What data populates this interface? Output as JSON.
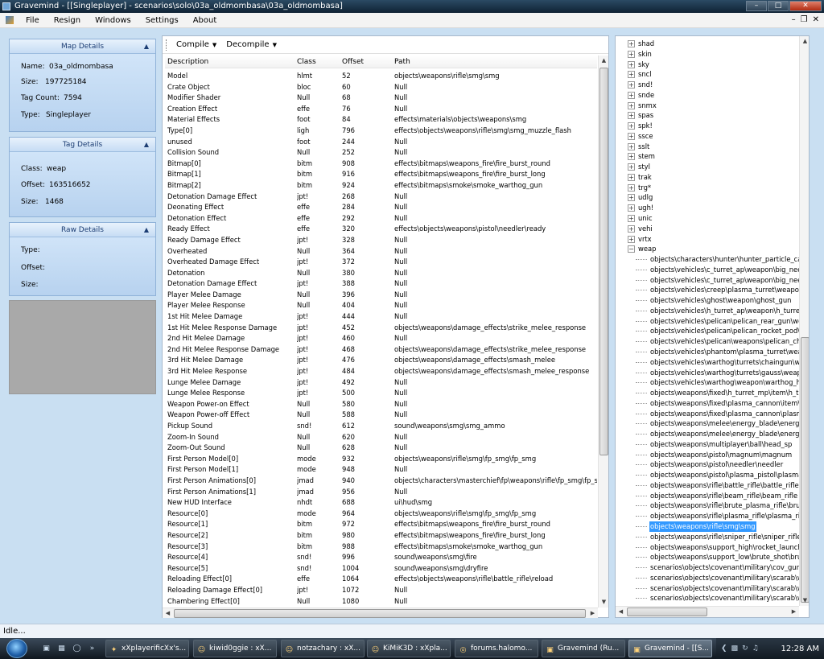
{
  "window": {
    "title": "Gravemind - [[Singleplayer] - scenarios\\solo\\03a_oldmombasa\\03a_oldmombasa]"
  },
  "menu": [
    "File",
    "Resign",
    "Windows",
    "Settings",
    "About"
  ],
  "map_details": {
    "title": "Map Details",
    "rows": [
      {
        "k": "Name:",
        "v": "03a_oldmombasa"
      },
      {
        "k": "Size:",
        "v": "197725184"
      },
      {
        "k": "Tag Count:",
        "v": "7594"
      },
      {
        "k": "Type:",
        "v": "Singleplayer"
      }
    ]
  },
  "tag_details": {
    "title": "Tag Details",
    "rows": [
      {
        "k": "Class:",
        "v": "weap"
      },
      {
        "k": "Offset:",
        "v": "163516652"
      },
      {
        "k": "Size:",
        "v": "1468"
      }
    ]
  },
  "raw_details": {
    "title": "Raw Details",
    "rows": [
      {
        "k": "Type:",
        "v": ""
      },
      {
        "k": "Offset:",
        "v": ""
      },
      {
        "k": "Size:",
        "v": ""
      }
    ]
  },
  "toolbar": {
    "compile": "Compile",
    "decompile": "Decompile"
  },
  "table": {
    "headers": [
      "Description",
      "Class",
      "Offset",
      "Path"
    ],
    "rows": [
      [
        "Model",
        "hlmt",
        "52",
        "objects\\weapons\\rifle\\smg\\smg"
      ],
      [
        "Crate Object",
        "bloc",
        "60",
        "Null"
      ],
      [
        "Modifier Shader",
        "Null",
        "68",
        "Null"
      ],
      [
        "Creation Effect",
        "effe",
        "76",
        "Null"
      ],
      [
        "Material Effects",
        "foot",
        "84",
        "effects\\materials\\objects\\weapons\\smg"
      ],
      [
        "Type[0]",
        "ligh",
        "796",
        "effects\\objects\\weapons\\rifle\\smg\\smg_muzzle_flash"
      ],
      [
        "unused",
        "foot",
        "244",
        "Null"
      ],
      [
        "Collision Sound",
        "Null",
        "252",
        "Null"
      ],
      [
        "Bitmap[0]",
        "bitm",
        "908",
        "effects\\bitmaps\\weapons_fire\\fire_burst_round"
      ],
      [
        "Bitmap[1]",
        "bitm",
        "916",
        "effects\\bitmaps\\weapons_fire\\fire_burst_long"
      ],
      [
        "Bitmap[2]",
        "bitm",
        "924",
        "effects\\bitmaps\\smoke\\smoke_warthog_gun"
      ],
      [
        "Detonation Damage Effect",
        "jpt!",
        "268",
        "Null"
      ],
      [
        "Deonating Effect",
        "effe",
        "284",
        "Null"
      ],
      [
        "Detonation Effect",
        "effe",
        "292",
        "Null"
      ],
      [
        "Ready Effect",
        "effe",
        "320",
        "effects\\objects\\weapons\\pistol\\needler\\ready"
      ],
      [
        "Ready Damage Effect",
        "jpt!",
        "328",
        "Null"
      ],
      [
        "Overheated",
        "Null",
        "364",
        "Null"
      ],
      [
        "Overheated Damage Effect",
        "jpt!",
        "372",
        "Null"
      ],
      [
        "Detonation",
        "Null",
        "380",
        "Null"
      ],
      [
        "Detonation Damage Effect",
        "jpt!",
        "388",
        "Null"
      ],
      [
        "Player Melee Damage",
        "Null",
        "396",
        "Null"
      ],
      [
        "Player Melee Response",
        "Null",
        "404",
        "Null"
      ],
      [
        "1st Hit Melee Damage",
        "jpt!",
        "444",
        "Null"
      ],
      [
        "1st Hit Melee Response Damage",
        "jpt!",
        "452",
        "objects\\weapons\\damage_effects\\strike_melee_response"
      ],
      [
        "2nd Hit Melee Damage",
        "jpt!",
        "460",
        "Null"
      ],
      [
        "2nd Hit Melee Response Damage",
        "jpt!",
        "468",
        "objects\\weapons\\damage_effects\\strike_melee_response"
      ],
      [
        "3rd Hit Melee Damage",
        "jpt!",
        "476",
        "objects\\weapons\\damage_effects\\smash_melee"
      ],
      [
        "3rd Hit Melee Response",
        "jpt!",
        "484",
        "objects\\weapons\\damage_effects\\smash_melee_response"
      ],
      [
        "Lunge Melee Damage",
        "jpt!",
        "492",
        "Null"
      ],
      [
        "Lunge Melee Response",
        "jpt!",
        "500",
        "Null"
      ],
      [
        "Weapon Power-on Effect",
        "Null",
        "580",
        "Null"
      ],
      [
        "Weapon Power-off Effect",
        "Null",
        "588",
        "Null"
      ],
      [
        "Pickup Sound",
        "snd!",
        "612",
        "sound\\weapons\\smg\\smg_ammo"
      ],
      [
        "Zoom-In Sound",
        "Null",
        "620",
        "Null"
      ],
      [
        "Zoom-Out Sound",
        "Null",
        "628",
        "Null"
      ],
      [
        "First Person Model[0]",
        "mode",
        "932",
        "objects\\weapons\\rifle\\smg\\fp_smg\\fp_smg"
      ],
      [
        "First Person Model[1]",
        "mode",
        "948",
        "Null"
      ],
      [
        "First Person Animations[0]",
        "jmad",
        "940",
        "objects\\characters\\masterchief\\fp\\weapons\\rifle\\fp_smg\\fp_smg"
      ],
      [
        "First Person Animations[1]",
        "jmad",
        "956",
        "Null"
      ],
      [
        "New HUD Interface",
        "nhdt",
        "688",
        "ui\\hud\\smg"
      ],
      [
        "Resource[0]",
        "mode",
        "964",
        "objects\\weapons\\rifle\\smg\\fp_smg\\fp_smg"
      ],
      [
        "Resource[1]",
        "bitm",
        "972",
        "effects\\bitmaps\\weapons_fire\\fire_burst_round"
      ],
      [
        "Resource[2]",
        "bitm",
        "980",
        "effects\\bitmaps\\weapons_fire\\fire_burst_long"
      ],
      [
        "Resource[3]",
        "bitm",
        "988",
        "effects\\bitmaps\\smoke\\smoke_warthog_gun"
      ],
      [
        "Resource[4]",
        "snd!",
        "996",
        "sound\\weapons\\smg\\fire"
      ],
      [
        "Resource[5]",
        "snd!",
        "1004",
        "sound\\weapons\\smg\\dryfire"
      ],
      [
        "Reloading Effect[0]",
        "effe",
        "1064",
        "effects\\objects\\weapons\\rifle\\battle_rifle\\reload"
      ],
      [
        "Reloading Damage Effect[0]",
        "jpt!",
        "1072",
        "Null"
      ],
      [
        "Chambering Effect[0]",
        "Null",
        "1080",
        "Null"
      ]
    ]
  },
  "tree": {
    "top_nodes": [
      "shad",
      "skin",
      "sky",
      "sncl",
      "snd!",
      "snde",
      "snmx",
      "spas",
      "spk!",
      "ssce",
      "sslt",
      "stem",
      "styl",
      "trak",
      "trg*",
      "udlg",
      "ugh!",
      "unic",
      "vehi",
      "vrtx"
    ],
    "open_node": "weap",
    "leaves": [
      "objects\\characters\\hunter\\hunter_particle_cann",
      "objects\\vehicles\\c_turret_ap\\weapon\\big_need",
      "objects\\vehicles\\c_turret_ap\\weapon\\big_need",
      "objects\\vehicles\\creep\\plasma_turret\\weapons",
      "objects\\vehicles\\ghost\\weapon\\ghost_gun",
      "objects\\vehicles\\h_turret_ap\\weapon\\h_turret_",
      "objects\\vehicles\\pelican\\pelican_rear_gun\\wea",
      "objects\\vehicles\\pelican\\pelican_rocket_pod\\w",
      "objects\\vehicles\\pelican\\weapons\\pelican_chin",
      "objects\\vehicles\\phantom\\plasma_turret\\weapo",
      "objects\\vehicles\\warthog\\turrets\\chaingun\\wea",
      "objects\\vehicles\\warthog\\turrets\\gauss\\weapon",
      "objects\\vehicles\\warthog\\weapon\\warthog_hor",
      "objects\\weapons\\fixed\\h_turret_mp\\item\\h_turr",
      "objects\\weapons\\fixed\\plasma_cannon\\item\\c_",
      "objects\\weapons\\fixed\\plasma_cannon\\plasma",
      "objects\\weapons\\melee\\energy_blade\\energy_",
      "objects\\weapons\\melee\\energy_blade\\energy_",
      "objects\\weapons\\multiplayer\\ball\\head_sp",
      "objects\\weapons\\pistol\\magnum\\magnum",
      "objects\\weapons\\pistol\\needler\\needler",
      "objects\\weapons\\pistol\\plasma_pistol\\plasma_p",
      "objects\\weapons\\rifle\\battle_rifle\\battle_rifle",
      "objects\\weapons\\rifle\\beam_rifle\\beam_rifle",
      "objects\\weapons\\rifle\\brute_plasma_rifle\\brute_",
      "objects\\weapons\\rifle\\plasma_rifle\\plasma_rifle",
      "objects\\weapons\\rifle\\smg\\smg",
      "objects\\weapons\\rifle\\sniper_rifle\\sniper_rifle",
      "objects\\weapons\\support_high\\rocket_launche",
      "objects\\weapons\\support_low\\brute_shot\\brute",
      "scenarios\\objects\\covenant\\military\\cov_gunto",
      "scenarios\\objects\\covenant\\military\\scarab\\wea",
      "scenarios\\objects\\covenant\\military\\scarab\\wea",
      "scenarios\\objects\\covenant\\military\\scarab\\wea"
    ],
    "selected_index": 26
  },
  "status": "Idle...",
  "taskbar": {
    "buttons": [
      "xXplayerificXx's...",
      "kiwid0ggie : xX...",
      "notzachary : xX...",
      "KiMiK3D : xXpla...",
      "forums.halomo...",
      "Gravemind (Ru...",
      "Gravemind - [[S..."
    ],
    "clock": "12:28 AM"
  },
  "colors": {
    "selection": "#3399ff",
    "panel_header": "#1c3d73"
  }
}
